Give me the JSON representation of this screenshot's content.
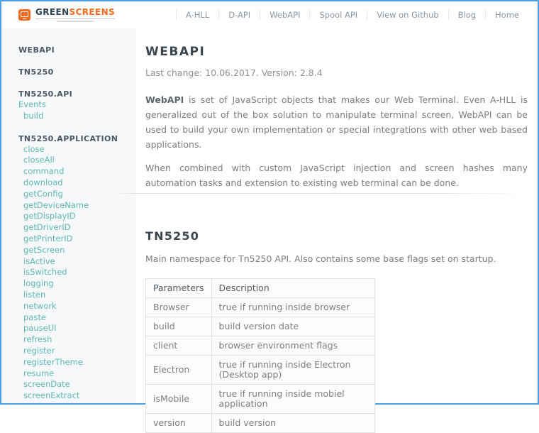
{
  "colors": {
    "screenshot_border": "#4a9fe8",
    "brand_orange": "#f26b21",
    "brand_navy": "#2e4356",
    "sidebar_link_teal": "#5cb8b2",
    "sidebar_bg": "#f7f8f9"
  },
  "header": {
    "logo": {
      "brand_green": "GREEN",
      "brand_screens": "SCREENS"
    },
    "nav": [
      "A-HLL",
      "D-API",
      "WebAPI",
      "Spool API",
      "View on Github",
      "Blog",
      "Home"
    ]
  },
  "sidebar": {
    "sections": [
      {
        "title": "WEBAPI",
        "links": []
      },
      {
        "title": "TN5250",
        "links": []
      },
      {
        "title": "TN5250.API",
        "links": [
          {
            "label": "Events",
            "indent": 0
          },
          {
            "label": "build",
            "indent": 1
          }
        ]
      },
      {
        "title": "TN5250.APPLICATION",
        "links": [
          {
            "label": "close",
            "indent": 1
          },
          {
            "label": "closeAll",
            "indent": 1
          },
          {
            "label": "command",
            "indent": 1
          },
          {
            "label": "download",
            "indent": 1
          },
          {
            "label": "getConfig",
            "indent": 1
          },
          {
            "label": "getDeviceName",
            "indent": 1
          },
          {
            "label": "getDisplayID",
            "indent": 1
          },
          {
            "label": "getDriverID",
            "indent": 1
          },
          {
            "label": "getPrinterID",
            "indent": 1
          },
          {
            "label": "getScreen",
            "indent": 1
          },
          {
            "label": "isActive",
            "indent": 1
          },
          {
            "label": "isSwitched",
            "indent": 1
          },
          {
            "label": "logging",
            "indent": 1
          },
          {
            "label": "listen",
            "indent": 1
          },
          {
            "label": "network",
            "indent": 1
          },
          {
            "label": "paste",
            "indent": 1
          },
          {
            "label": "pauseUI",
            "indent": 1
          },
          {
            "label": "refresh",
            "indent": 1
          },
          {
            "label": "register",
            "indent": 1
          },
          {
            "label": "registerTheme",
            "indent": 1
          },
          {
            "label": "resume",
            "indent": 1
          },
          {
            "label": "screenDate",
            "indent": 1
          },
          {
            "label": "screenExtract",
            "indent": 1
          }
        ]
      }
    ]
  },
  "main": {
    "title": "WEBAPI",
    "meta": "Last change: 10.06.2017. Version: 2.8.4",
    "para1_lead": "WebAPI",
    "para1_rest": " is set of JavaScript objects that makes our Web Terminal. Even A-HLL is generalized out of the box solution to manipulate terminal screen, WebAPI can be used to build your own implementation or special integrations with other web based applications.",
    "para2": "When combined with custom JavaScript injection and screen hashes many automation tasks and extension to existing web terminal can be done.",
    "section2": {
      "title": "TN5250",
      "intro": "Main namespace for Tn5250 API. Also contains some base flags set on startup.",
      "table": {
        "headers": [
          "Parameters",
          "Description"
        ],
        "rows": [
          [
            "Browser",
            "true if running inside browser"
          ],
          [
            "build",
            "build version date"
          ],
          [
            "client",
            "browser environment flags"
          ],
          [
            "Electron",
            "true if running inside Electron (Desktop app)"
          ],
          [
            "isMobile",
            "true if running inside mobiel application"
          ],
          [
            "version",
            "build version"
          ]
        ]
      }
    }
  }
}
